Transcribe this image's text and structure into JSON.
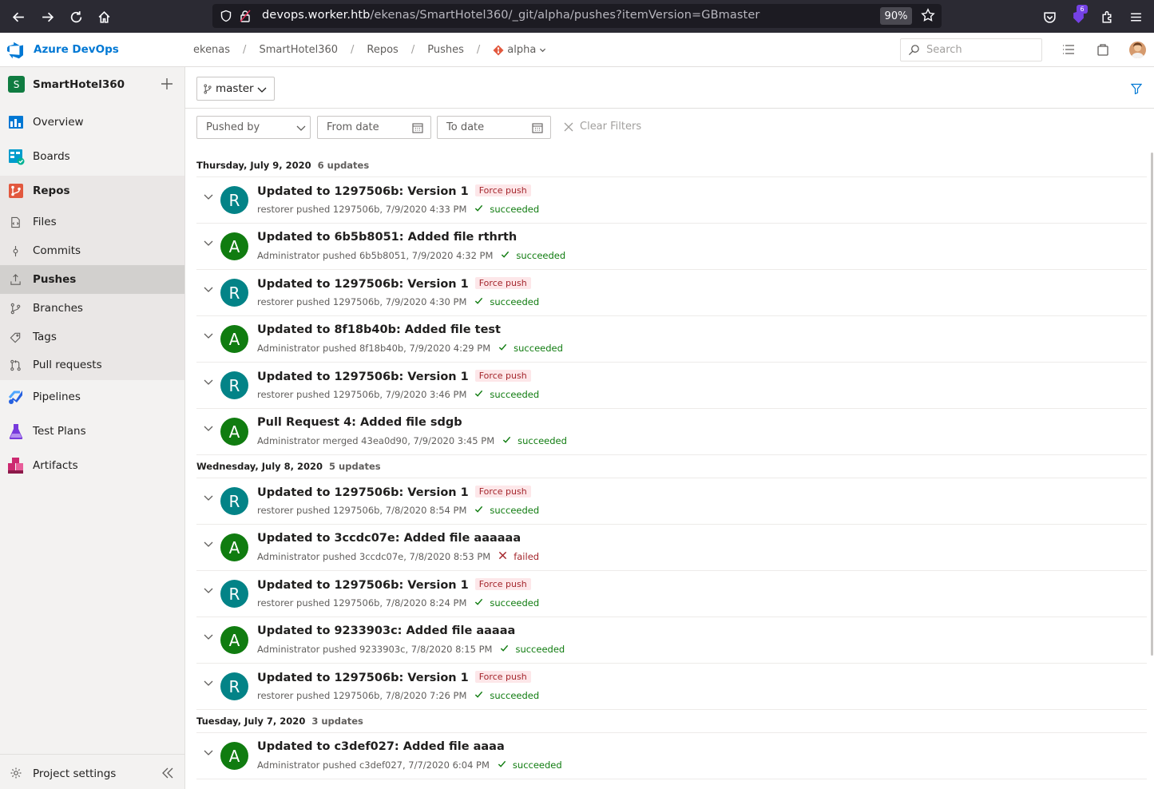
{
  "browser": {
    "url_host": "devops.worker.htb",
    "url_path": "/ekenas/SmartHotel360/_git/alpha/pushes?itemVersion=GBmaster",
    "zoom": "90%",
    "extension_badge": "6"
  },
  "app": {
    "title": "Azure DevOps",
    "breadcrumbs": [
      "ekenas",
      "SmartHotel360",
      "Repos",
      "Pushes"
    ],
    "repo_crumb": "alpha",
    "search_placeholder": "Search"
  },
  "project": {
    "initial": "S",
    "name": "SmartHotel360"
  },
  "sidebar": {
    "items": [
      {
        "label": "Overview",
        "icon": "overview-icon"
      },
      {
        "label": "Boards",
        "icon": "boards-icon"
      },
      {
        "label": "Repos",
        "icon": "repos-icon"
      },
      {
        "label": "Pipelines",
        "icon": "pipelines-icon"
      },
      {
        "label": "Test Plans",
        "icon": "test-plans-icon"
      },
      {
        "label": "Artifacts",
        "icon": "artifacts-icon"
      }
    ],
    "repo_subitems": [
      {
        "label": "Files",
        "icon": "files-icon"
      },
      {
        "label": "Commits",
        "icon": "commits-icon"
      },
      {
        "label": "Pushes",
        "icon": "pushes-icon"
      },
      {
        "label": "Branches",
        "icon": "branches-icon"
      },
      {
        "label": "Tags",
        "icon": "tags-icon"
      },
      {
        "label": "Pull requests",
        "icon": "pull-requests-icon"
      }
    ],
    "project_settings": "Project settings"
  },
  "toolbar": {
    "branch": "master",
    "pushed_by_placeholder": "Pushed by",
    "from_date_placeholder": "From date",
    "to_date_placeholder": "To date",
    "clear_filters": "Clear Filters"
  },
  "colors": {
    "avatar_R": "#038387",
    "avatar_A": "#107c10",
    "accent": "#0078d4"
  },
  "groups": [
    {
      "date": "Thursday, July 9, 2020",
      "count": "6 updates",
      "pushes": [
        {
          "initial": "R",
          "title": "Updated to 1297506b: Version 1",
          "badge": "Force push",
          "sub": "restorer pushed 1297506b, 7/9/2020 4:33 PM",
          "status": "succeeded"
        },
        {
          "initial": "A",
          "title": "Updated to 6b5b8051: Added file rthrth",
          "badge": "",
          "sub": "Administrator pushed 6b5b8051, 7/9/2020 4:32 PM",
          "status": "succeeded"
        },
        {
          "initial": "R",
          "title": "Updated to 1297506b: Version 1",
          "badge": "Force push",
          "sub": "restorer pushed 1297506b, 7/9/2020 4:30 PM",
          "status": "succeeded"
        },
        {
          "initial": "A",
          "title": "Updated to 8f18b40b: Added file test",
          "badge": "",
          "sub": "Administrator pushed 8f18b40b, 7/9/2020 4:29 PM",
          "status": "succeeded"
        },
        {
          "initial": "R",
          "title": "Updated to 1297506b: Version 1",
          "badge": "Force push",
          "sub": "restorer pushed 1297506b, 7/9/2020 3:46 PM",
          "status": "succeeded"
        },
        {
          "initial": "A",
          "title": "Pull Request 4: Added file sdgb",
          "badge": "",
          "sub": "Administrator merged 43ea0d90, 7/9/2020 3:45 PM",
          "status": "succeeded"
        }
      ]
    },
    {
      "date": "Wednesday, July 8, 2020",
      "count": "5 updates",
      "pushes": [
        {
          "initial": "R",
          "title": "Updated to 1297506b: Version 1",
          "badge": "Force push",
          "sub": "restorer pushed 1297506b, 7/8/2020 8:54 PM",
          "status": "succeeded"
        },
        {
          "initial": "A",
          "title": "Updated to 3ccdc07e: Added file aaaaaa",
          "badge": "",
          "sub": "Administrator pushed 3ccdc07e, 7/8/2020 8:53 PM",
          "status": "failed"
        },
        {
          "initial": "R",
          "title": "Updated to 1297506b: Version 1",
          "badge": "Force push",
          "sub": "restorer pushed 1297506b, 7/8/2020 8:24 PM",
          "status": "succeeded"
        },
        {
          "initial": "A",
          "title": "Updated to 9233903c: Added file aaaaa",
          "badge": "",
          "sub": "Administrator pushed 9233903c, 7/8/2020 8:15 PM",
          "status": "succeeded"
        },
        {
          "initial": "R",
          "title": "Updated to 1297506b: Version 1",
          "badge": "Force push",
          "sub": "restorer pushed 1297506b, 7/8/2020 7:26 PM",
          "status": "succeeded"
        }
      ]
    },
    {
      "date": "Tuesday, July 7, 2020",
      "count": "3 updates",
      "pushes": [
        {
          "initial": "A",
          "title": "Updated to c3def027: Added file aaaa",
          "badge": "",
          "sub": "Administrator pushed c3def027, 7/7/2020 6:04 PM",
          "status": "succeeded"
        }
      ]
    }
  ]
}
